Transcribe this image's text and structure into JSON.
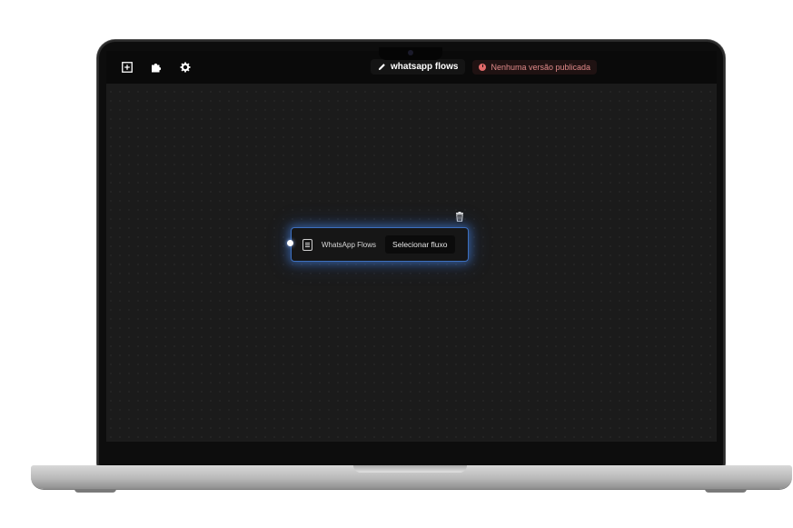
{
  "toolbar": {
    "icons": [
      "add-square-icon",
      "puzzle-icon",
      "gear-icon"
    ],
    "flow_name": "whatsapp flows",
    "status_text": "Nenhuma versão publicada",
    "status_color": "#e26a6a"
  },
  "node": {
    "title": "WhatsApp Flows",
    "select_label": "Selecionar fluxo",
    "icon": "clipboard-icon",
    "accent_color": "#3c6fbf"
  }
}
